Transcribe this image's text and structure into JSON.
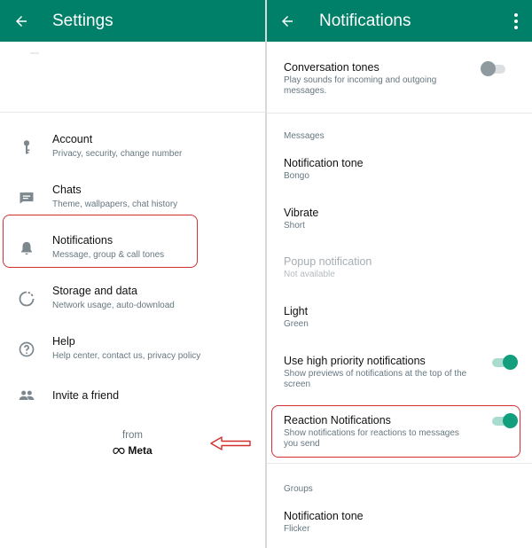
{
  "left": {
    "title": "Settings",
    "items": [
      {
        "label": "Account",
        "sub": "Privacy, security, change number",
        "icon": "key-icon"
      },
      {
        "label": "Chats",
        "sub": "Theme, wallpapers, chat history",
        "icon": "chat-icon"
      },
      {
        "label": "Notifications",
        "sub": "Message, group & call tones",
        "icon": "bell-icon"
      },
      {
        "label": "Storage and data",
        "sub": "Network usage, auto-download",
        "icon": "storage-icon"
      },
      {
        "label": "Help",
        "sub": "Help center, contact us, privacy policy",
        "icon": "help-icon"
      },
      {
        "label": "Invite a friend",
        "sub": "",
        "icon": "people-icon"
      }
    ],
    "from_text": "from",
    "meta_text": "Meta"
  },
  "right": {
    "title": "Notifications",
    "conversation_tones": {
      "title": "Conversation tones",
      "desc": "Play sounds for incoming and outgoing messages.",
      "enabled": false
    },
    "messages_section": "Messages",
    "notification_tone": {
      "title": "Notification tone",
      "value": "Bongo"
    },
    "vibrate": {
      "title": "Vibrate",
      "value": "Short"
    },
    "popup": {
      "title": "Popup notification",
      "value": "Not available"
    },
    "light": {
      "title": "Light",
      "value": "Green"
    },
    "high_priority": {
      "title": "Use high priority notifications",
      "desc": "Show previews of notifications at the top of the screen",
      "enabled": true
    },
    "reaction": {
      "title": "Reaction Notifications",
      "desc": "Show notifications for reactions to messages you send",
      "enabled": true
    },
    "groups_section": "Groups",
    "group_tone": {
      "title": "Notification tone",
      "value": "Flicker"
    }
  },
  "colors": {
    "appbar": "#008069",
    "toggle_on": "#139f7e",
    "annotation": "#d32f2f",
    "secondary_text": "#667781"
  }
}
